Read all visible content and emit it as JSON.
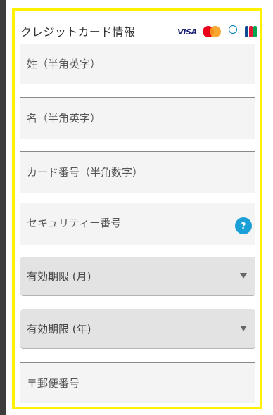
{
  "form": {
    "title": "クレジットカード情報",
    "card_logos": [
      "VISA",
      "MasterCard",
      "Diners Club International",
      "JCB"
    ],
    "fields": {
      "last_name": {
        "placeholder": "姓（半角英字）"
      },
      "first_name": {
        "placeholder": "名（半角英字）"
      },
      "card_number": {
        "placeholder": "カード番号（半角数字）"
      },
      "security_code": {
        "placeholder": "セキュリティー番号",
        "help_icon": "?"
      },
      "exp_month": {
        "label": "有効期限 (月)"
      },
      "exp_year": {
        "label": "有効期限 (年)"
      },
      "postal_code": {
        "placeholder": "〒郵便番号"
      }
    }
  },
  "colors": {
    "frame": "#fff200",
    "help_icon": "#1a9fd6",
    "field_bg": "#f4f4f4",
    "select_bg": "#e3e3e3"
  }
}
